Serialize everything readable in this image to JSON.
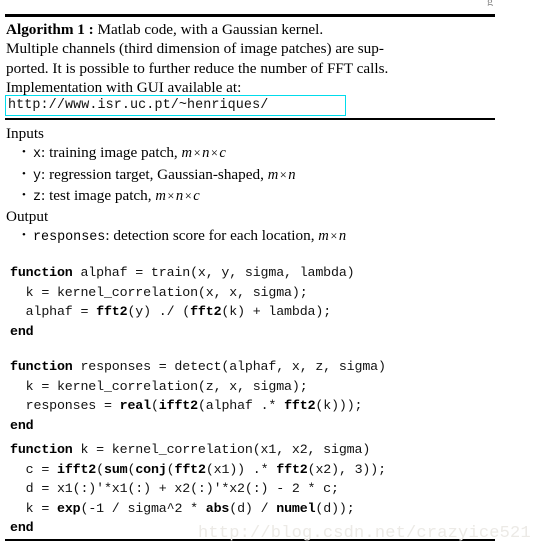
{
  "document": {
    "background_color": "#ffffff",
    "text_color": "#000000",
    "url_box_border_color": "#00dcec",
    "watermark_color": "#eceae6"
  },
  "top_clipped_glyph": "g",
  "header": {
    "title_bold": "Algorithm 1 :",
    "title_rest": " Matlab code, with a Gaussian kernel.",
    "line2": "Multiple channels (third dimension of image patches) are sup-",
    "line3": "ported. It is possible to further reduce the number of FFT calls.",
    "line4": "Implementation with GUI available at:"
  },
  "url_box": {
    "url": "http://www.isr.uc.pt/~henriques/"
  },
  "inputs": {
    "heading": "Inputs",
    "bullet_glyph": "•",
    "items": [
      {
        "var": "x",
        "colon": ":",
        "description": " training image patch, ",
        "dims": [
          "m",
          "n",
          "c"
        ],
        "times_glyph": "×"
      },
      {
        "var": "y",
        "colon": ":",
        "description": " regression target, Gaussian-shaped, ",
        "dims": [
          "m",
          "n"
        ],
        "times_glyph": "×"
      },
      {
        "var": "z",
        "colon": ":",
        "description": " test image patch, ",
        "dims": [
          "m",
          "n",
          "c"
        ],
        "times_glyph": "×"
      }
    ]
  },
  "output": {
    "heading": "Output",
    "bullet_glyph": "•",
    "items": [
      {
        "var": "responses",
        "colon": ":",
        "description": " detection score for each location, ",
        "dims": [
          "m",
          "n"
        ],
        "times_glyph": "×"
      }
    ]
  },
  "code_blocks": [
    {
      "name": "train",
      "lines": [
        [
          {
            "t": "function",
            "b": true
          },
          {
            "t": " alphaf = train(x, y, sigma, lambda)",
            "b": false
          }
        ],
        [
          {
            "t": "  k = kernel_correlation(x, x, sigma);",
            "b": false
          }
        ],
        [
          {
            "t": "  alphaf = ",
            "b": false
          },
          {
            "t": "fft2",
            "b": true
          },
          {
            "t": "(y) ./ (",
            "b": false
          },
          {
            "t": "fft2",
            "b": true
          },
          {
            "t": "(k) + lambda);",
            "b": false
          }
        ],
        [
          {
            "t": "end",
            "b": true
          }
        ]
      ]
    },
    {
      "name": "detect",
      "lines": [
        [
          {
            "t": "function",
            "b": true
          },
          {
            "t": " responses = detect(alphaf, x, z, sigma)",
            "b": false
          }
        ],
        [
          {
            "t": "  k = kernel_correlation(z, x, sigma);",
            "b": false
          }
        ],
        [
          {
            "t": "  responses = ",
            "b": false
          },
          {
            "t": "real",
            "b": true
          },
          {
            "t": "(",
            "b": false
          },
          {
            "t": "ifft2",
            "b": true
          },
          {
            "t": "(alphaf .* ",
            "b": false
          },
          {
            "t": "fft2",
            "b": true
          },
          {
            "t": "(k)));",
            "b": false
          }
        ],
        [
          {
            "t": "end",
            "b": true
          }
        ]
      ]
    },
    {
      "name": "kernel_correlation",
      "lines": [
        [
          {
            "t": "function",
            "b": true
          },
          {
            "t": " k = kernel_correlation(x1, x2, sigma)",
            "b": false
          }
        ],
        [
          {
            "t": "  c = ",
            "b": false
          },
          {
            "t": "ifft2",
            "b": true
          },
          {
            "t": "(",
            "b": false
          },
          {
            "t": "sum",
            "b": true
          },
          {
            "t": "(",
            "b": false
          },
          {
            "t": "conj",
            "b": true
          },
          {
            "t": "(",
            "b": false
          },
          {
            "t": "fft2",
            "b": true
          },
          {
            "t": "(x1)) .* ",
            "b": false
          },
          {
            "t": "fft2",
            "b": true
          },
          {
            "t": "(x2), 3));",
            "b": false
          }
        ],
        [
          {
            "t": "  d = x1(:)'*x1(:) + x2(:)'*x2(:) - 2 * c;",
            "b": false
          }
        ],
        [
          {
            "t": "  k = ",
            "b": false
          },
          {
            "t": "exp",
            "b": true
          },
          {
            "t": "(-1 / sigma^2 * ",
            "b": false
          },
          {
            "t": "abs",
            "b": true
          },
          {
            "t": "(d) / ",
            "b": false
          },
          {
            "t": "numel",
            "b": true
          },
          {
            "t": "(d));",
            "b": false
          }
        ],
        [
          {
            "t": "end",
            "b": true
          }
        ]
      ]
    }
  ],
  "watermark": {
    "text": "http://blog.csdn.net/crazyice521"
  }
}
